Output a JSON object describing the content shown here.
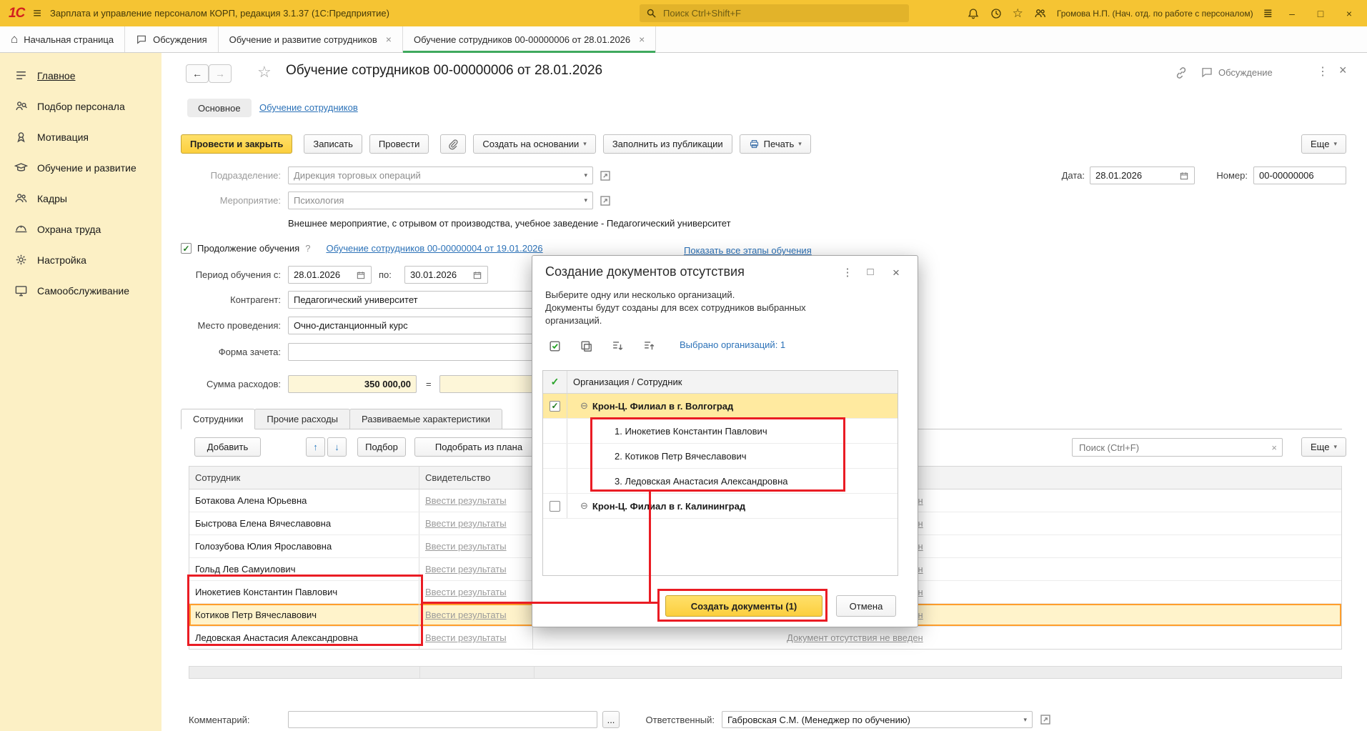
{
  "colors": {
    "topbar_yellow": "#f5c433",
    "sidebar_yellow": "#fcf0c5",
    "active_tab_green": "#3fa95e",
    "primary_button_yellow": "#fccf3e",
    "link_blue": "#2c72b8",
    "annotation_red": "#ea1c24",
    "current_row_orange": "#ff9e2c",
    "logo_red": "#d21f1f"
  },
  "glyphs": {
    "burger": "≡",
    "home": "⌂",
    "back": "←",
    "forward": "→",
    "star": "☆",
    "kebab": "⋮",
    "close": "×",
    "dropdown": "▾",
    "up": "↑",
    "down": "↓",
    "more_dots": "...",
    "help": "?",
    "tree_collapse": "⊖",
    "check": "✓",
    "minimize": "–",
    "maximize": "□",
    "window_menu": "≣"
  },
  "topbar": {
    "logo": "1С",
    "title": "Зарплата и управление персоналом КОРП, редакция 3.1.37 (1С:Предприятие)",
    "search_placeholder": "Поиск Ctrl+Shift+F",
    "user": "Громова Н.П. (Нач. отд. по работе с персоналом)"
  },
  "tabbar": {
    "home": "Начальная страница",
    "tabs": [
      {
        "label": "Обсуждения"
      },
      {
        "label": "Обучение и развитие сотрудников"
      },
      {
        "label": "Обучение сотрудников 00-00000006 от 28.01.2026"
      }
    ]
  },
  "sidebar": {
    "items": [
      {
        "label": "Главное"
      },
      {
        "label": "Подбор персонала"
      },
      {
        "label": "Мотивация"
      },
      {
        "label": "Обучение и развитие"
      },
      {
        "label": "Кадры"
      },
      {
        "label": "Охрана труда"
      },
      {
        "label": "Настройка"
      },
      {
        "label": "Самообслуживание"
      }
    ]
  },
  "doc": {
    "title": "Обучение сотрудников 00-00000006 от 28.01.2026",
    "discussion": "Обсуждение",
    "nav": {
      "main": "Основное",
      "link": "Обучение сотрудников"
    },
    "toolbar": {
      "post_close": "Провести и закрыть",
      "write": "Записать",
      "post": "Провести",
      "create_based": "Создать на основании",
      "fill_from_pub": "Заполнить из публикации",
      "print": "Печать",
      "more": "Еще"
    },
    "fields": {
      "department_label": "Подразделение:",
      "department": "Дирекция торговых операций",
      "event_label": "Мероприятие:",
      "event": "Психология",
      "description": "Внешнее мероприятие, с отрывом от производства, учебное заведение - Педагогический университет",
      "continuation_label": "Продолжение обучения",
      "continuation_link": "Обучение сотрудников 00-00000004 от 19.01.2026",
      "show_stages": "Показать все этапы обучения",
      "period_label": "Период обучения с:",
      "period_from": "28.01.2026",
      "period_to_label": "по:",
      "period_to": "30.01.2026",
      "contractor_label": "Контрагент:",
      "contractor": "Педагогический университет",
      "venue_label": "Место проведения:",
      "venue": "Очно-дистанционный курс",
      "credit_label": "Форма зачета:",
      "amount_label": "Сумма расходов:",
      "amount": "350 000,00",
      "equals": "=",
      "date_label": "Дата:",
      "date": "28.01.2026",
      "number_label": "Номер:",
      "number": "00-00000006"
    },
    "table": {
      "tabs": [
        "Сотрудники",
        "Прочие расходы",
        "Развиваемые характеристики"
      ],
      "buttons": {
        "add": "Добавить",
        "pick": "Подбор",
        "pick_plan": "Подобрать из плана"
      },
      "search_placeholder": "Поиск (Ctrl+F)",
      "more": "Еще",
      "col_employee": "Сотрудник",
      "col_certificate": "Свидетельство",
      "enter_results": "Ввести результаты",
      "absence_link": "Документ отсутствия не введен",
      "rows": [
        {
          "name": "Ботакова Алена Юрьевна"
        },
        {
          "name": "Быстрова Елена Вячеславовна"
        },
        {
          "name": "Голозубова Юлия Ярославовна"
        },
        {
          "name": "Гольд Лев Самуилович"
        },
        {
          "name": "Инокетиев Константин Павлович"
        },
        {
          "name": "Котиков Петр Вячеславович"
        },
        {
          "name": "Ледовская Анастасия Александровна"
        }
      ]
    },
    "footer": {
      "comment_label": "Комментарий:",
      "comment_more": "...",
      "responsible_label": "Ответственный:",
      "responsible": "Габровская С.М. (Менеджер по обучению)"
    }
  },
  "dialog": {
    "title": "Создание документов отсутствия",
    "body1": "Выберите одну или несколько организаций.",
    "body2": "Документы будут созданы для всех сотрудников выбранных организаций.",
    "selected_info": "Выбрано организаций: 1",
    "col_header": "Организация / Сотрудник",
    "org1": "Крон-Ц. Филиал в г. Волгоград",
    "org1_children": [
      "1. Инокетиев Константин Павлович",
      "2. Котиков Петр Вячеславович",
      "3. Ледовская Анастасия Александровна"
    ],
    "org2": "Крон-Ц. Филиал в г. Калининград",
    "create_button": "Создать документы (1)",
    "cancel_button": "Отмена"
  }
}
